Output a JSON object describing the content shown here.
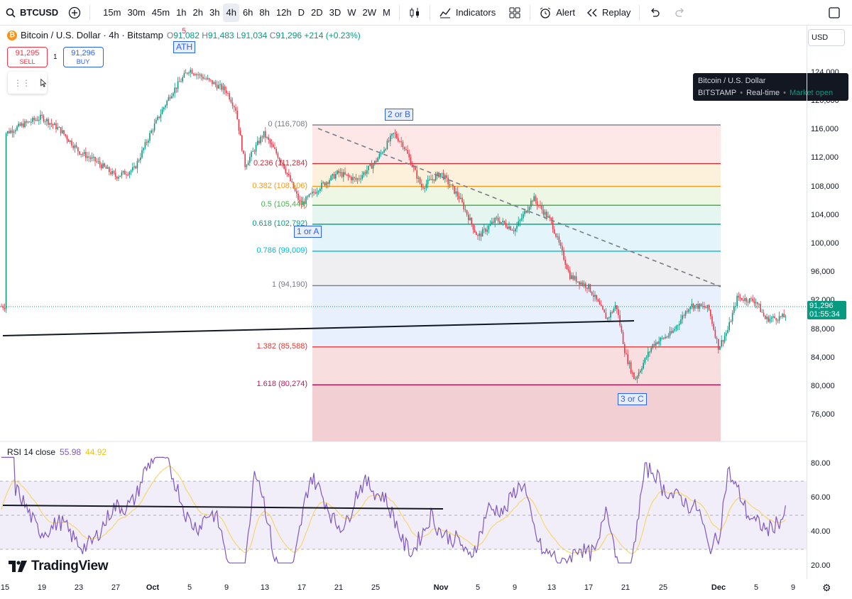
{
  "toolbar": {
    "symbol": "BTCUSD",
    "intervals": [
      "15m",
      "30m",
      "45m",
      "1h",
      "2h",
      "3h",
      "4h",
      "6h",
      "8h",
      "12h",
      "D",
      "2D",
      "3D",
      "W",
      "2W",
      "M"
    ],
    "active_interval": "4h",
    "indicators_label": "Indicators",
    "alert_label": "Alert",
    "replay_label": "Replay"
  },
  "legend": {
    "title": "Bitcoin / U.S. Dollar · 4h · Bitstamp",
    "o_key": "O",
    "o": "91,082",
    "h_key": "H",
    "h": "91,483",
    "l_key": "L",
    "l": "91,034",
    "c_key": "C",
    "c": "91,296",
    "change": "+214 (+0.23%)",
    "coin_symbol": "₿"
  },
  "trade": {
    "sell_price": "91,295",
    "sell_label": "SELL",
    "spread": "1",
    "buy_price": "91,296",
    "buy_label": "BUY"
  },
  "tooltip": {
    "title": "Bitcoin / U.S. Dollar",
    "exchange": "BITSTAMP",
    "mode": "Real-time",
    "status": "Market open"
  },
  "currency": "USD",
  "price_axis": [
    "124,000",
    "120,000",
    "116,000",
    "112,000",
    "108,000",
    "104,000",
    "100,000",
    "96,000",
    "92,000",
    "88,000",
    "84,000",
    "80,000",
    "76,000"
  ],
  "last_price": {
    "price": "91,296",
    "countdown": "01:55:34"
  },
  "fib_levels": [
    {
      "label": "0 (116,708)",
      "price": 116708
    },
    {
      "label": "0.236 (111,284)",
      "price": 111284
    },
    {
      "label": "0.382 (108,106)",
      "price": 108106
    },
    {
      "label": "0.5 (105,449)",
      "price": 105449
    },
    {
      "label": "0.618 (102,792)",
      "price": 102792
    },
    {
      "label": "0.786 (99,009)",
      "price": 99009
    },
    {
      "label": "1 (94,190)",
      "price": 94190
    },
    {
      "label": "1.382 (85,588)",
      "price": 85588
    },
    {
      "label": "1.618 (80,274)",
      "price": 80274
    }
  ],
  "fib_colors": [
    "#787b86",
    "#c2313a",
    "#f59b23",
    "#4caf50",
    "#089981",
    "#00bcd4",
    "#787b86",
    "#e53935",
    "#c2185b"
  ],
  "waves": {
    "ath": "ATH",
    "ath_flag": "5",
    "a": "1 or A",
    "b": "2 or B",
    "c": "3 or C"
  },
  "rsi": {
    "title": "RSI 14 close",
    "value": "55.98",
    "ma_value": "44.92",
    "axis": [
      "80.00",
      "60.00",
      "40.00",
      "20.00"
    ],
    "line_color": "#7e57c2",
    "ma_color": "#f5d76e"
  },
  "x_axis": [
    {
      "t": "15"
    },
    {
      "t": "19"
    },
    {
      "t": "23"
    },
    {
      "t": "27"
    },
    {
      "t": "Oct",
      "bold": true
    },
    {
      "t": "5"
    },
    {
      "t": "9"
    },
    {
      "t": "13"
    },
    {
      "t": "17"
    },
    {
      "t": "21"
    },
    {
      "t": "25"
    },
    {
      "t": "Nov",
      "bold": true
    },
    {
      "t": "5"
    },
    {
      "t": "9"
    },
    {
      "t": "13"
    },
    {
      "t": "17"
    },
    {
      "t": "21"
    },
    {
      "t": "25"
    },
    {
      "t": "Dec",
      "bold": true
    },
    {
      "t": "5"
    },
    {
      "t": "9"
    }
  ],
  "brand": "TradingView",
  "colors": {
    "up": "#089981",
    "down": "#f23645",
    "accent": "#2962ff"
  },
  "chart_data": {
    "type": "candlestick",
    "symbol": "BTCUSD",
    "interval": "4h",
    "ylim": [
      74000,
      126000
    ],
    "price_path": [
      [
        "Sep 15",
        115500
      ],
      [
        "Sep 17",
        116800
      ],
      [
        "Sep 19",
        117800
      ],
      [
        "Sep 21",
        116000
      ],
      [
        "Sep 23",
        113000
      ],
      [
        "Sep 25",
        111500
      ],
      [
        "Sep 27",
        109500
      ],
      [
        "Sep 29",
        110500
      ],
      [
        "Oct 1",
        116000
      ],
      [
        "Oct 3",
        121000
      ],
      [
        "Oct 5",
        124500
      ],
      [
        "Oct 7",
        123000
      ],
      [
        "Oct 9",
        121500
      ],
      [
        "Oct 10",
        119000
      ],
      [
        "Oct 11",
        111000
      ],
      [
        "Oct 13",
        115500
      ],
      [
        "Oct 15",
        111500
      ],
      [
        "Oct 17",
        105500
      ],
      [
        "Oct 19",
        108000
      ],
      [
        "Oct 21",
        110000
      ],
      [
        "Oct 23",
        109000
      ],
      [
        "Oct 25",
        111500
      ],
      [
        "Oct 27",
        115500
      ],
      [
        "Oct 28",
        114000
      ],
      [
        "Oct 30",
        108000
      ],
      [
        "Nov 1",
        110000
      ],
      [
        "Nov 3",
        106500
      ],
      [
        "Nov 5",
        101000
      ],
      [
        "Nov 7",
        103500
      ],
      [
        "Nov 9",
        102000
      ],
      [
        "Nov 11",
        106500
      ],
      [
        "Nov 13",
        103000
      ],
      [
        "Nov 15",
        95500
      ],
      [
        "Nov 17",
        94000
      ],
      [
        "Nov 19",
        89500
      ],
      [
        "Nov 20",
        91500
      ],
      [
        "Nov 21",
        84500
      ],
      [
        "Nov 22",
        81000
      ],
      [
        "Nov 24",
        86000
      ],
      [
        "Nov 26",
        87500
      ],
      [
        "Nov 28",
        91500
      ],
      [
        "Nov 30",
        91000
      ],
      [
        "Dec 1",
        85500
      ],
      [
        "Dec 2",
        88000
      ],
      [
        "Dec 3",
        92500
      ],
      [
        "Dec 5",
        92000
      ],
      [
        "Dec 6",
        89500
      ],
      [
        "Dec 8",
        89800
      ],
      [
        "Dec 9",
        91296
      ]
    ]
  }
}
